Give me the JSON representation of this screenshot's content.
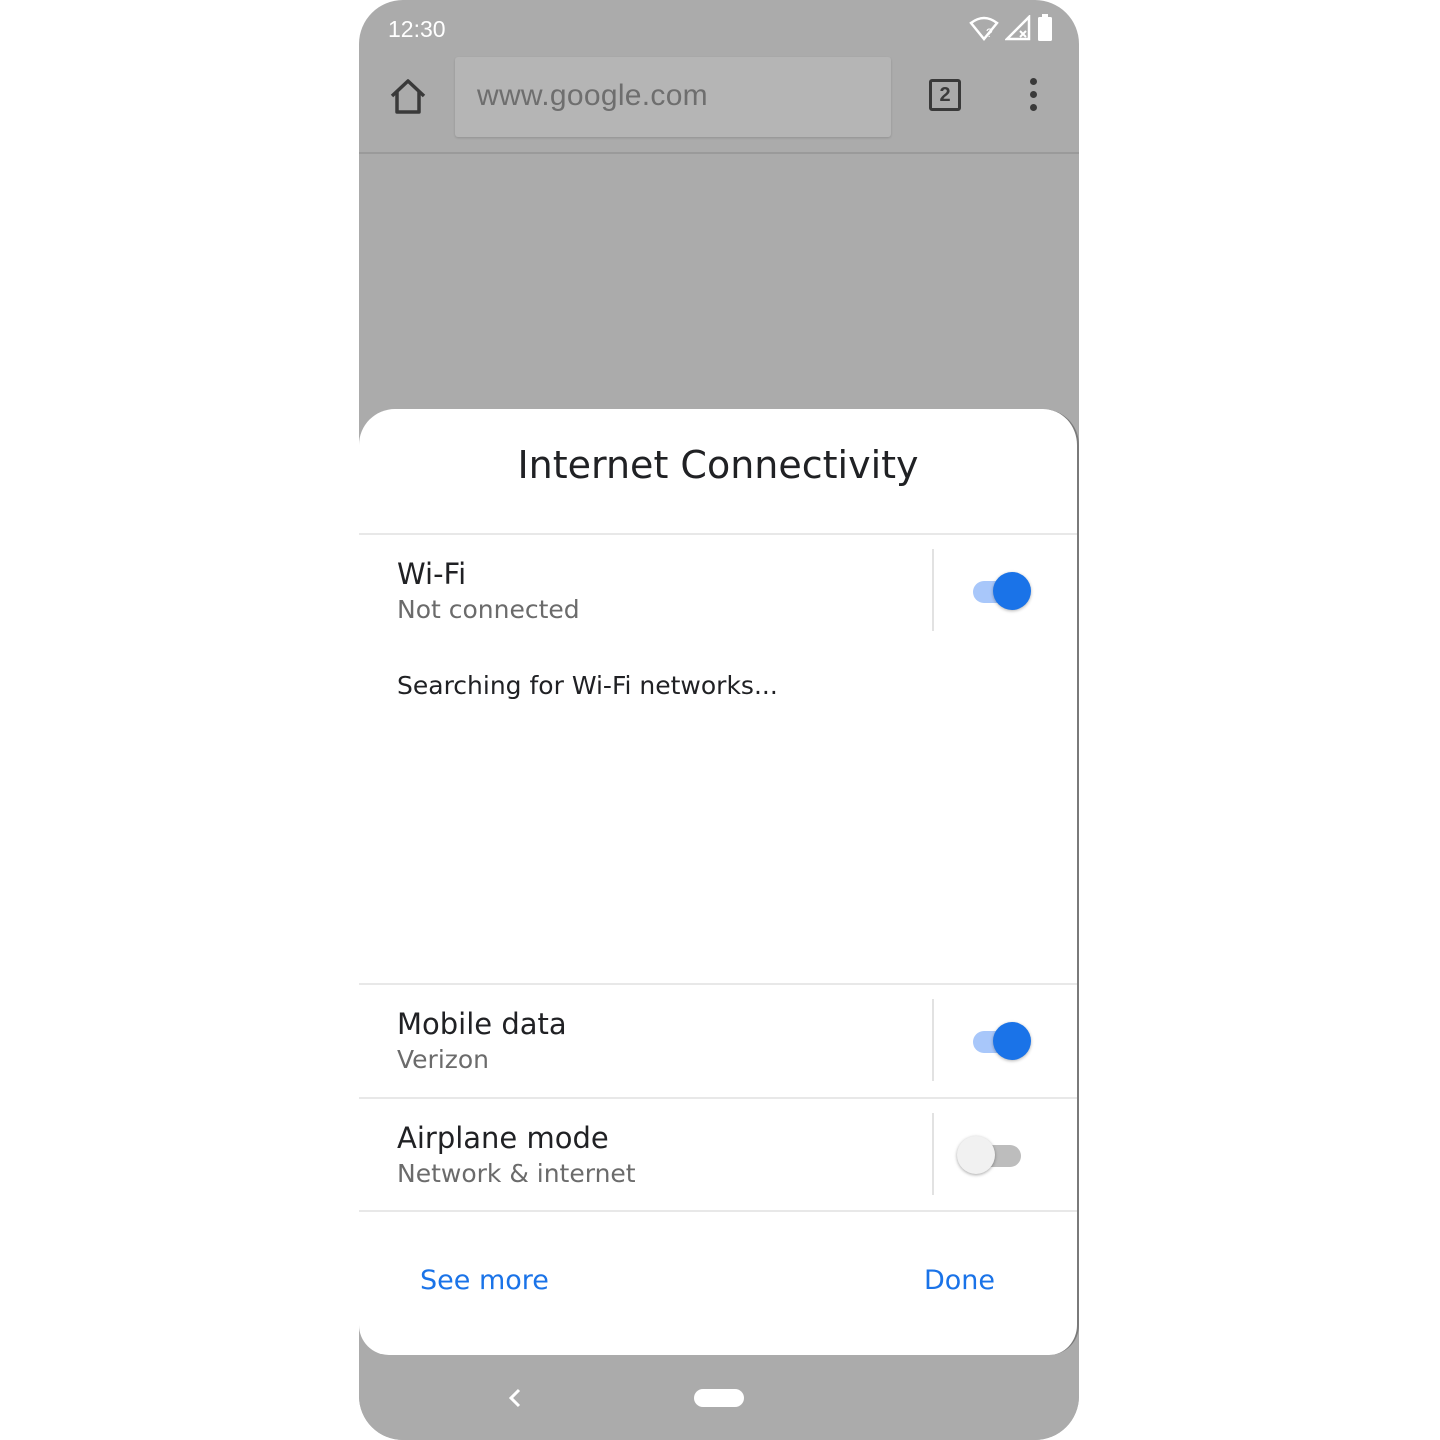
{
  "status_bar": {
    "time": "12:30"
  },
  "browser": {
    "url": "www.google.com",
    "tab_count": "2"
  },
  "sheet": {
    "title": "Internet Connectivity",
    "wifi": {
      "title": "Wi-Fi",
      "subtitle": "Not connected",
      "enabled": true,
      "searching": "Searching for Wi-Fi networks..."
    },
    "mobile_data": {
      "title": "Mobile data",
      "subtitle": "Verizon",
      "enabled": true
    },
    "airplane_mode": {
      "title": "Airplane mode",
      "subtitle": "Network & internet",
      "enabled": false
    },
    "actions": {
      "see_more": "See more",
      "done": "Done"
    }
  },
  "colors": {
    "accent": "#1a73e8",
    "scrim": "#ababab"
  },
  "icons": [
    "home-icon",
    "wifi-question-icon",
    "signal-off-icon",
    "battery-icon",
    "tabs-icon",
    "more-vert-icon",
    "back-icon"
  ]
}
